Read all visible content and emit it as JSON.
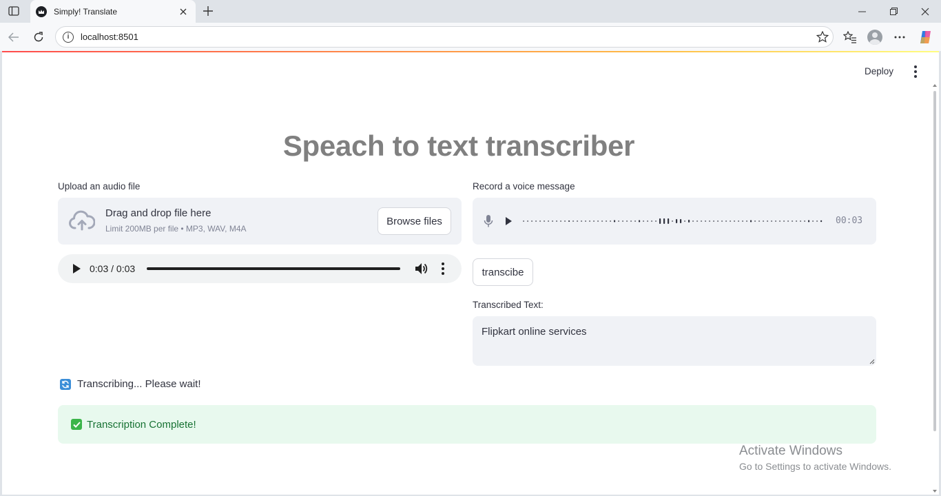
{
  "browser": {
    "tab_title": "Simply! Translate",
    "url": "localhost:8501"
  },
  "app": {
    "deploy_label": "Deploy",
    "title": "Speach to text transcriber",
    "upload": {
      "label": "Upload an audio file",
      "drag_text": "Drag and drop file here",
      "limit_text": "Limit 200MB per file • MP3, WAV, M4A",
      "browse_label": "Browse files"
    },
    "player": {
      "time": "0:03 / 0:03",
      "progress": 1.0
    },
    "recorder": {
      "label": "Record a voice message",
      "duration": "00:03"
    },
    "transcribe_button": "transcibe",
    "transcribed": {
      "label": "Transcribed Text:",
      "value": "Flipkart online services"
    },
    "status": "Transcribing... Please wait!",
    "success": "Transcription Complete!"
  },
  "watermark": {
    "title": "Activate Windows",
    "subtitle": "Go to Settings to activate Windows."
  },
  "colors": {
    "title_gray": "#808080",
    "widget_bg": "#f0f2f6",
    "success_bg": "#e8f9ee",
    "success_text": "#177233",
    "accent_red": "#ff4b4b"
  }
}
